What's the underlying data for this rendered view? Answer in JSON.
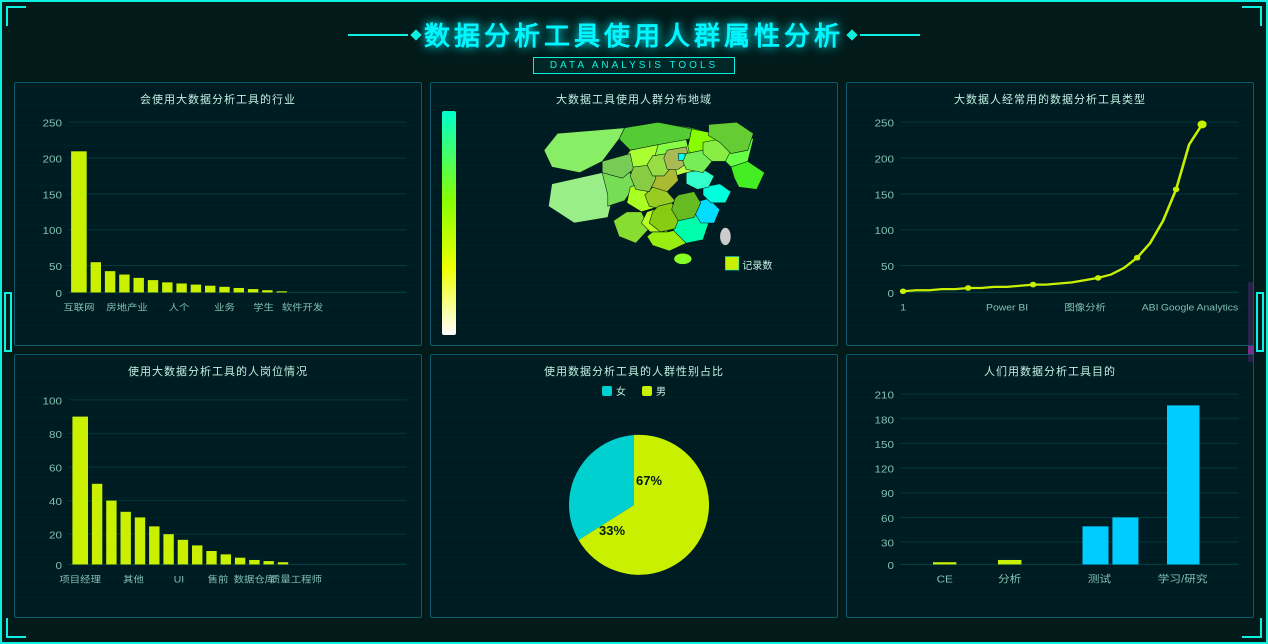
{
  "header": {
    "title": "数据分析工具使用人群属性分析",
    "subtitle": "DATA ANALYSIS TOOLS"
  },
  "panels": {
    "industry": {
      "title": "会使用大数据分析工具的行业",
      "y_labels": [
        "250",
        "200",
        "150",
        "100",
        "50",
        "0"
      ],
      "x_labels": [
        "互联网",
        "房地产业",
        "人个",
        "业务",
        "学生",
        "软件开发"
      ],
      "bars": [
        200,
        30,
        20,
        18,
        12,
        10,
        8,
        7,
        6,
        5,
        4,
        3,
        3,
        2,
        2,
        1,
        1,
        1
      ]
    },
    "map": {
      "title": "大数据工具使用人群分布地域",
      "legend": "记录数"
    },
    "tools": {
      "title": "大数据人经常用的数据分析工具类型",
      "y_labels": [
        "250",
        "200",
        "150",
        "100",
        "50",
        "0"
      ],
      "x_labels": [
        "1",
        "Power BI",
        "图像分析",
        "ABI",
        "Google Analytics"
      ]
    },
    "position": {
      "title": "使用大数据分析工具的人岗位情况",
      "y_labels": [
        "100",
        "80",
        "60",
        "40",
        "20",
        "0"
      ],
      "x_labels": [
        "项目经理",
        "其他",
        "UI",
        "售前",
        "数据仓库",
        "质量工程师"
      ]
    },
    "gender": {
      "title": "使用数据分析工具的人群性别占比",
      "legend_female": "女",
      "legend_male": "男",
      "female_pct": "33%",
      "male_pct": "67%"
    },
    "purpose": {
      "title": "人们用数据分析工具目的",
      "y_labels": [
        "210",
        "180",
        "150",
        "120",
        "90",
        "60",
        "30",
        "0"
      ],
      "x_labels": [
        "CE",
        "分析",
        "测试",
        "学习/研究"
      ]
    }
  }
}
